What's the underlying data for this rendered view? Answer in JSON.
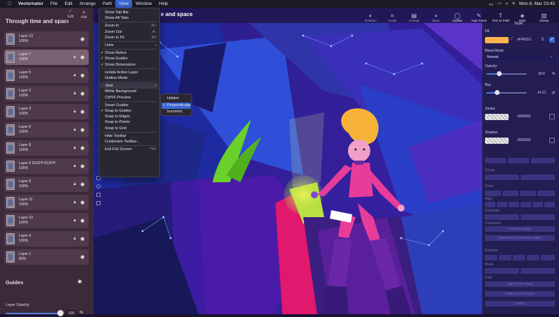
{
  "menubar": {
    "apple": "",
    "app": "Vectornator",
    "items": [
      "File",
      "Edit",
      "Arrange",
      "Path",
      "View",
      "Window",
      "Help"
    ],
    "clock": "Mon 8. Mar 23:43"
  },
  "document": {
    "title_visible": "e and space"
  },
  "toolbar": {
    "items": [
      {
        "label": "Boolean",
        "icon": "boolean-icon"
      },
      {
        "label": "Guide",
        "icon": "guide-icon"
      },
      {
        "label": "Arrange",
        "icon": "arrange-icon"
      },
      {
        "label": "Mask",
        "icon": "mask-icon"
      },
      {
        "label": "Outline",
        "icon": "outline-icon"
      },
      {
        "label": "Auto Trace",
        "icon": "auto-trace-icon"
      },
      {
        "label": "Text on Path",
        "icon": "text-on-path-icon"
      },
      {
        "label": "Style",
        "icon": "style-icon"
      },
      {
        "label": "Library",
        "icon": "library-icon"
      }
    ]
  },
  "left_panel": {
    "title": "Through time and space",
    "edit": "Edit",
    "add": "Add",
    "layers": [
      {
        "name": "Layer 13",
        "opacity": "100%",
        "selected": false,
        "locked": false
      },
      {
        "name": "Layer 7",
        "opacity": "100%",
        "selected": true,
        "locked": true
      },
      {
        "name": "Layer 5",
        "opacity": "100%",
        "selected": false,
        "locked": true
      },
      {
        "name": "Layer 2",
        "opacity": "100%",
        "selected": false,
        "locked": true
      },
      {
        "name": "Layer 3",
        "opacity": "100%",
        "selected": false,
        "locked": true
      },
      {
        "name": "Layer 6",
        "opacity": "100%",
        "selected": false,
        "locked": true
      },
      {
        "name": "Layer 8",
        "opacity": "100%",
        "selected": false,
        "locked": true
      },
      {
        "name": "Layer 6 0126?f 0126?f",
        "opacity": "100%",
        "selected": false,
        "locked": true
      },
      {
        "name": "Layer 9",
        "opacity": "100%",
        "selected": false,
        "locked": true
      },
      {
        "name": "Layer 11",
        "opacity": "100%",
        "selected": false,
        "locked": true
      },
      {
        "name": "Layer 10",
        "opacity": "100%",
        "selected": false,
        "locked": true
      },
      {
        "name": "Layer 4",
        "opacity": "100%",
        "selected": false,
        "locked": true
      },
      {
        "name": "Layer 1",
        "opacity": "80%",
        "selected": false,
        "locked": false
      }
    ],
    "guides": "Guides",
    "layer_opacity_label": "Layer Opacity",
    "layer_opacity_value": "100",
    "layer_opacity_fraction": 1.0,
    "layer_opacity_unit": "%"
  },
  "view_menu": {
    "items": [
      {
        "label": "Show Tab Bar",
        "check": false,
        "shortcut": "",
        "submenu": false
      },
      {
        "label": "Show All Tabs",
        "check": false,
        "shortcut": "",
        "submenu": false
      },
      {
        "sep": true
      },
      {
        "label": "Zoom In",
        "check": false,
        "shortcut": "⌘+",
        "submenu": false
      },
      {
        "label": "Zoom Out",
        "check": false,
        "shortcut": "⌘-",
        "submenu": false
      },
      {
        "label": "Zoom to Fit",
        "check": false,
        "shortcut": "⌘0",
        "submenu": false
      },
      {
        "sep": true
      },
      {
        "label": "Units",
        "check": false,
        "shortcut": "",
        "submenu": true
      },
      {
        "sep": true
      },
      {
        "label": "Show Rulers",
        "check": true,
        "shortcut": "",
        "submenu": false
      },
      {
        "label": "Show Guides",
        "check": true,
        "shortcut": "",
        "submenu": false
      },
      {
        "label": "Show Dimensions",
        "check": true,
        "shortcut": "",
        "submenu": false
      },
      {
        "sep": true
      },
      {
        "label": "Isolate Active Layer",
        "check": false,
        "shortcut": "",
        "submenu": false
      },
      {
        "label": "Outline Mode",
        "check": false,
        "shortcut": "",
        "submenu": false
      },
      {
        "sep": true
      },
      {
        "label": "Grid",
        "check": false,
        "shortcut": "",
        "submenu": true,
        "highlighted": true
      },
      {
        "label": "White Background",
        "check": false,
        "shortcut": "",
        "submenu": false
      },
      {
        "label": "CMYK Preview",
        "check": false,
        "shortcut": "",
        "submenu": false
      },
      {
        "sep": true
      },
      {
        "label": "Smart Guides",
        "check": false,
        "shortcut": "",
        "submenu": false
      },
      {
        "label": "Snap to Guides",
        "check": true,
        "shortcut": "",
        "submenu": false
      },
      {
        "label": "Snap to Edges",
        "check": false,
        "shortcut": "",
        "submenu": false
      },
      {
        "label": "Snap to Points",
        "check": false,
        "shortcut": "",
        "submenu": false
      },
      {
        "label": "Snap to Grid",
        "check": false,
        "shortcut": "",
        "submenu": false
      },
      {
        "sep": true
      },
      {
        "label": "Hide Toolbar",
        "check": false,
        "shortcut": "",
        "submenu": false
      },
      {
        "label": "Customize Toolbar...",
        "check": false,
        "shortcut": "",
        "submenu": false
      },
      {
        "sep": true
      },
      {
        "label": "Exit Full Screen",
        "check": false,
        "shortcut": "^⌘F",
        "submenu": false
      }
    ]
  },
  "grid_submenu": {
    "items": [
      {
        "label": "Hidden",
        "check": false,
        "selected": false
      },
      {
        "label": "Perpendicular",
        "check": true,
        "selected": true
      },
      {
        "label": "Isometric",
        "check": false,
        "selected": false
      }
    ]
  },
  "right_panel": {
    "style_header": "Style",
    "fill_label": "Fill",
    "fill_hex": "#FFB251",
    "fill_color": "#FFB251",
    "blend_label": "Blend Mode",
    "blend_value": "Normal",
    "opacity_label": "Opacity",
    "opacity_value": "30.6",
    "opacity_unit": "%",
    "opacity_fraction": 0.306,
    "blur_label": "Blur",
    "blur_value": "14.21",
    "blur_unit": "pt",
    "blur_fraction": 0.25,
    "stroke_label": "Stroke",
    "stroke_hex": "#000000",
    "shadow_label": "Shadow",
    "shadow_hex": "#000000",
    "group_label": "Group",
    "order_label": "Order",
    "align_label": "Align",
    "distribute_label": "Distribute",
    "transform_label": "Transform",
    "transform_again": "Transform Again",
    "duplicate_again": "Duplicate and Transform Again",
    "boolean_label": "Boolean",
    "mask_label": "Mask",
    "path_label": "Path",
    "add_anchor": "Add Anchor Points",
    "delete_anchor": "Delete Anchor Points",
    "outline": "Outline"
  }
}
